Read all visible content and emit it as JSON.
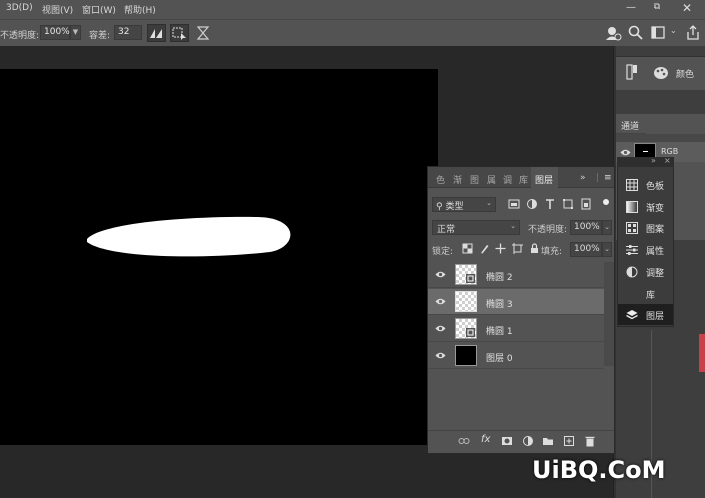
{
  "menubar": {
    "items": [
      "3D(D)",
      "视图(V)",
      "窗口(W)",
      "帮助(H)"
    ]
  },
  "options": {
    "opacity_label": "不透明度:",
    "opacity_value": "100%",
    "tolerance_label": "容差:",
    "tolerance_value": "32"
  },
  "color_panel": {
    "label": "颜色"
  },
  "channels": {
    "tab": "通道",
    "rgb_label": "RGB"
  },
  "layers": {
    "tabs": [
      "色",
      "渐",
      "图",
      "属",
      "调",
      "库"
    ],
    "active_tab": "图层",
    "filter": "类型",
    "blend_mode": "正常",
    "opacity_label": "不透明度:",
    "opacity_value": "100%",
    "lock_label": "锁定:",
    "fill_label": "填充:",
    "fill_value": "100%",
    "rows": [
      {
        "name": "椭圆 2",
        "thumb": "checker-shape",
        "selected": false
      },
      {
        "name": "椭圆 3",
        "thumb": "checker",
        "selected": true
      },
      {
        "name": "椭圆 1",
        "thumb": "checker-shape",
        "selected": false
      },
      {
        "name": "图层 0",
        "thumb": "black",
        "selected": false
      }
    ],
    "footer_fx": "fx"
  },
  "flyout": {
    "items": [
      {
        "label": "色板",
        "icon": "swatches-icon"
      },
      {
        "label": "渐变",
        "icon": "gradient-icon"
      },
      {
        "label": "图案",
        "icon": "pattern-icon"
      },
      {
        "label": "属性",
        "icon": "properties-icon"
      },
      {
        "label": "调整",
        "icon": "adjustments-icon"
      },
      {
        "label": "库",
        "icon": ""
      },
      {
        "label": "图层",
        "icon": "layers-icon"
      }
    ]
  },
  "watermark": "UiBQ.CoM",
  "colors": {
    "ui_dark": "#282828",
    "panel": "#535353",
    "canvas": "#000000",
    "shape": "#ffffff",
    "accent_red": "#c8404a"
  }
}
